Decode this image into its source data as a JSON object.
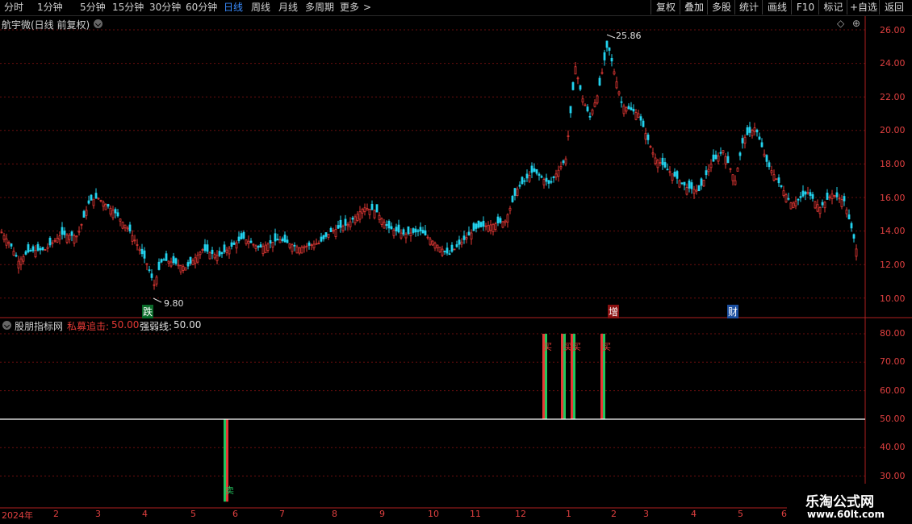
{
  "periods": [
    "分时",
    "1分钟",
    "5分钟",
    "15分钟",
    "30分钟",
    "60分钟",
    "日线",
    "周线",
    "月线",
    "多周期",
    "更多"
  ],
  "active_period": "日线",
  "more_arrow": ">",
  "toolbar": [
    "复权",
    "叠加",
    "多股",
    "统计",
    "画线",
    "F10",
    "标记",
    "+自选",
    "返回"
  ],
  "price_panel": {
    "title": "航宇微(日线 前复权)",
    "max_label": "25.86",
    "min_label": "9.80",
    "y_ticks": [
      "26.00",
      "24.00",
      "22.00",
      "20.00",
      "18.00",
      "16.00",
      "14.00",
      "12.00",
      "10.00"
    ],
    "markers": [
      {
        "text": "跌",
        "color": "#22c55e"
      },
      {
        "text": "增",
        "color": "#e53935"
      },
      {
        "text": "财",
        "color": "#3b82f6"
      }
    ]
  },
  "indicator_panel": {
    "title": "股朋指标网",
    "series1_label": "私募追击:",
    "series1_value": "50.00",
    "series2_label": "强弱线:",
    "series2_value": "50.00",
    "y_ticks": [
      "80.00",
      "70.00",
      "60.00",
      "50.00",
      "40.00",
      "30.00"
    ],
    "buy_text": "买",
    "sell_text": "卖"
  },
  "x_axis": {
    "months": [
      "2024年",
      "2",
      "3",
      "4",
      "5",
      "6",
      "7",
      "8",
      "9",
      "10",
      "11",
      "12",
      "1",
      "2",
      "3",
      "4",
      "5",
      "6"
    ]
  },
  "watermark": {
    "line1": "乐淘公式网",
    "line2": "www.60lt.com"
  },
  "colors": {
    "up": "#e53935",
    "down": "#22d3ee",
    "grid": "#7a1010",
    "axis": "#e04040"
  }
}
